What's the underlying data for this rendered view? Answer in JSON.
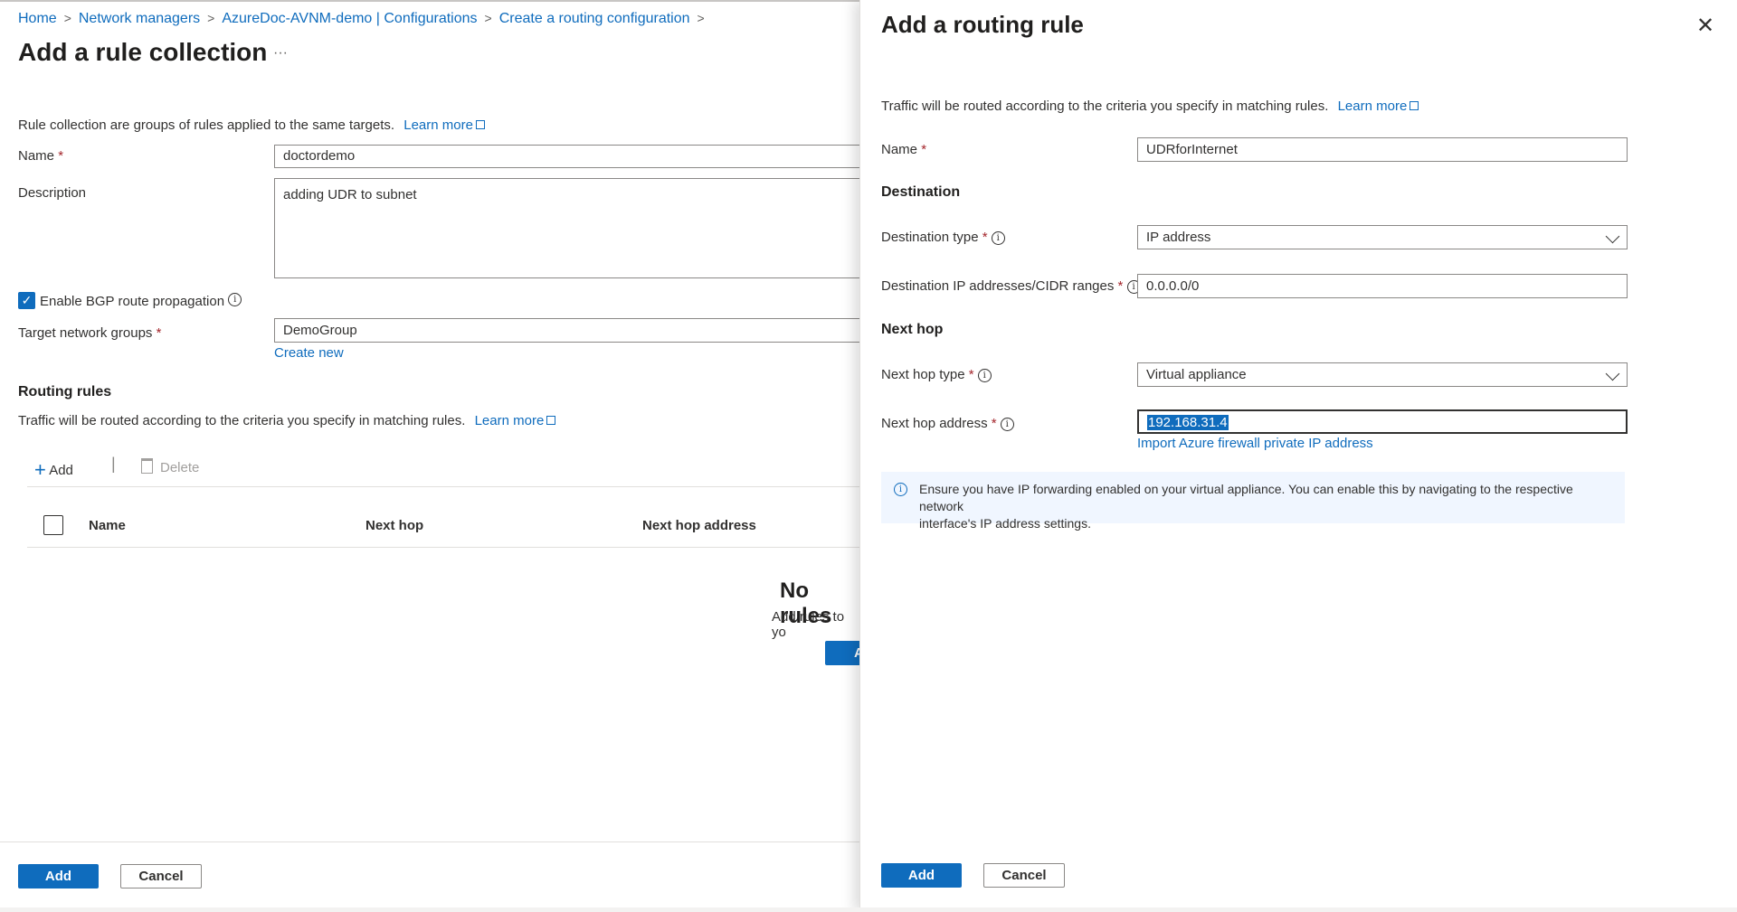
{
  "breadcrumb": [
    "Home",
    "Network managers",
    "AzureDoc-AVNM-demo | Configurations",
    "Create a routing configuration"
  ],
  "page": {
    "title": "Add a rule collection",
    "more_label": "···",
    "intro": "Rule collection are groups of rules applied to the same targets.",
    "learn_more": "Learn more"
  },
  "form": {
    "name_label": "Name",
    "name_value": "doctordemo",
    "description_label": "Description",
    "description_value": "adding UDR to subnet",
    "bgp_label": "Enable BGP route propagation",
    "bgp_checked": true,
    "target_label": "Target network groups",
    "target_value": "DemoGroup",
    "create_new": "Create new"
  },
  "routing_rules": {
    "heading": "Routing rules",
    "intro": "Traffic will be routed according to the criteria you specify in matching rules.",
    "learn_more": "Learn more",
    "toolbar": {
      "add": "Add",
      "delete": "Delete"
    },
    "columns": [
      "Name",
      "Next hop",
      "Next hop address"
    ],
    "empty_title": "No rules",
    "empty_sub": "Add rules to yo",
    "empty_button": "A"
  },
  "footer": {
    "add": "Add",
    "cancel": "Cancel"
  },
  "panel": {
    "title": "Add a routing rule",
    "intro": "Traffic will be routed according to the criteria you specify in matching rules.",
    "learn_more": "Learn more",
    "name_label": "Name",
    "name_value": "UDRforInternet",
    "destination_heading": "Destination",
    "dest_type_label": "Destination type",
    "dest_type_value": "IP address",
    "dest_ip_label": "Destination IP addresses/CIDR ranges",
    "dest_ip_value": "0.0.0.0/0",
    "next_hop_heading": "Next hop",
    "next_hop_type_label": "Next hop type",
    "next_hop_type_value": "Virtual appliance",
    "next_hop_address_label": "Next hop address",
    "next_hop_address_value": "192.168.31.4",
    "import_link": "Import Azure firewall private IP address",
    "info_text_1": "Ensure you have IP forwarding enabled on your virtual appliance. You can enable this by navigating to the respective network",
    "info_text_2": "interface's IP address settings.",
    "add": "Add",
    "cancel": "Cancel"
  },
  "colors": {
    "accent": "#0f6cbd",
    "required": "#a4262c",
    "info_bg": "#f0f6ff"
  }
}
